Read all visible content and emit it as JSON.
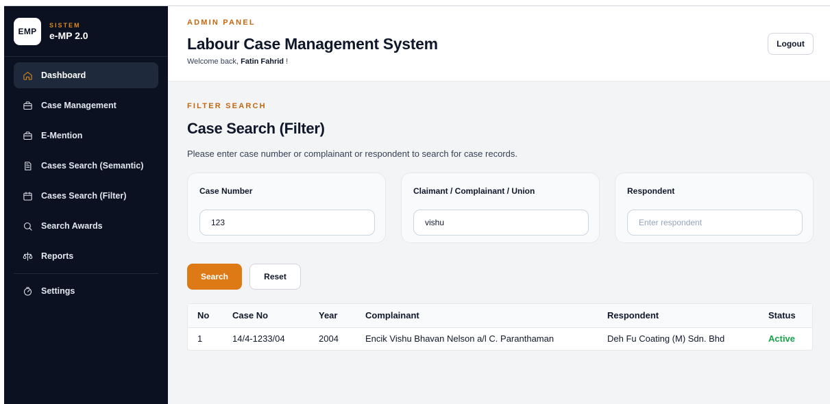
{
  "brand": {
    "logo_text": "EMP",
    "kicker": "SISTEM",
    "name": "e-MP 2.0"
  },
  "sidebar": {
    "items": [
      {
        "label": "Dashboard",
        "icon": "home-icon",
        "active": true
      },
      {
        "label": "Case Management",
        "icon": "briefcase-icon"
      },
      {
        "label": "E-Mention",
        "icon": "briefcase-icon"
      },
      {
        "label": "Cases Search (Semantic)",
        "icon": "document-icon"
      },
      {
        "label": "Cases Search (Filter)",
        "icon": "calendar-icon"
      },
      {
        "label": "Search Awards",
        "icon": "search-icon"
      },
      {
        "label": "Reports",
        "icon": "scale-icon"
      }
    ],
    "settings": {
      "label": "Settings",
      "icon": "stopwatch-icon"
    }
  },
  "header": {
    "kicker": "ADMIN PANEL",
    "title": "Labour Case Management System",
    "welcome_prefix": "Welcome back, ",
    "user_name": "Fatin Fahrid",
    "welcome_suffix": " !",
    "logout_label": "Logout"
  },
  "section": {
    "kicker": "FILTER SEARCH",
    "title": "Case Search (Filter)",
    "description": "Please enter case number or complainant or respondent to search for case records."
  },
  "filters": {
    "case_number": {
      "label": "Case Number",
      "value": "123",
      "placeholder": ""
    },
    "claimant": {
      "label": "Claimant / Complainant / Union",
      "value": "vishu",
      "placeholder": ""
    },
    "respondent": {
      "label": "Respondent",
      "value": "",
      "placeholder": "Enter respondent"
    }
  },
  "actions": {
    "search_label": "Search",
    "reset_label": "Reset"
  },
  "table": {
    "columns": [
      "No",
      "Case No",
      "Year",
      "Complainant",
      "Respondent",
      "Status"
    ],
    "rows": [
      [
        "1",
        "14/4-1233/04",
        "2004",
        "Encik Vishu Bhavan Nelson a/l C. Paranthaman",
        "Deh Fu Coating (M) Sdn. Bhd",
        "Active"
      ]
    ]
  },
  "colors": {
    "accent": "#dd7a16",
    "sidebar_bg": "#0b1120",
    "status_active": "#16a34a"
  }
}
